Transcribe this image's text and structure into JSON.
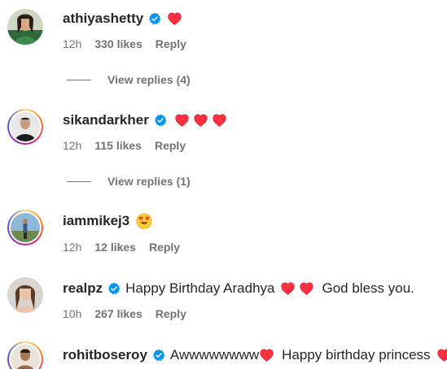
{
  "comments": [
    {
      "username": "athiyashetty",
      "verified": true,
      "text": "",
      "time": "12h",
      "likes": "330 likes",
      "reply": "Reply",
      "view_replies": "View replies (4)"
    },
    {
      "username": "sikandarkher",
      "verified": true,
      "text": "",
      "time": "12h",
      "likes": "115 likes",
      "reply": "Reply",
      "view_replies": "View replies (1)"
    },
    {
      "username": "iammikej3",
      "verified": false,
      "text": "",
      "time": "12h",
      "likes": "12 likes",
      "reply": "Reply"
    },
    {
      "username": "realpz",
      "verified": true,
      "text": "Happy Birthday Aradhya",
      "text2": "God bless you.",
      "time": "10h",
      "likes": "267 likes",
      "reply": "Reply"
    },
    {
      "username": "rohitboseroy",
      "verified": true,
      "text": "Awwwwwwww",
      "text2": "Happy birthday princess"
    }
  ],
  "colors": {
    "verified_blue": "#0095f6",
    "heart_red": "#ff3040",
    "muted_text": "#737373"
  },
  "icons": {
    "verified": "verified-badge-icon",
    "heart": "red-heart-emoji",
    "heart_eyes": "heart-eyes-emoji"
  }
}
